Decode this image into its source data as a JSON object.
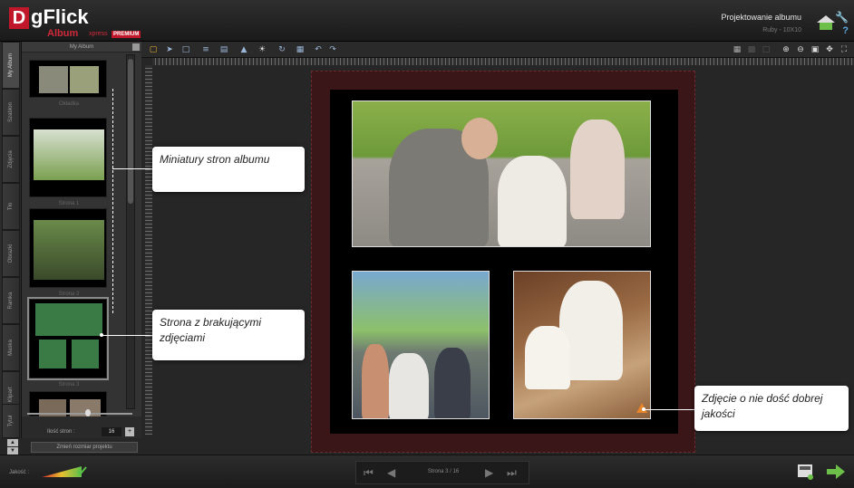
{
  "app": {
    "brand_letter": "D",
    "brand_name": "gFlick",
    "product": "Album",
    "edition": "xpress",
    "badge": "PREMIUM",
    "project_title": "Projektowanie albumu",
    "project_subtitle": "Ruby - 10X10"
  },
  "tabs": [
    {
      "label": "My Album"
    },
    {
      "label": "Szablon"
    },
    {
      "label": "Zdjęcia"
    },
    {
      "label": "Tło"
    },
    {
      "label": "Obrazki"
    },
    {
      "label": "Ramka"
    },
    {
      "label": "Maska"
    },
    {
      "label": "Klipart"
    },
    {
      "label": "Tytuł"
    }
  ],
  "panel": {
    "header": "My Album",
    "thumbs": [
      {
        "caption": "Okładka"
      },
      {
        "caption": "Strona 1"
      },
      {
        "caption": "Strona 2"
      },
      {
        "caption": "Strona 3"
      }
    ],
    "count_label": "Ilość stron :",
    "count_value": "16",
    "count_btn": "+",
    "resize_label": "Zmień rozmiar projektu"
  },
  "toolbar": {
    "left_icons": [
      "lock-icon",
      "pointer-icon",
      "frame-icon",
      "align-left-icon",
      "align-center-icon",
      "arrange-icon",
      "brightness-icon",
      "rotate-icon",
      "layers-icon",
      "undo-icon",
      "redo-icon"
    ],
    "right_icons": [
      "grid-icon",
      "grid2-icon",
      "grid3-icon",
      "zoom-in-icon",
      "zoom-out-icon",
      "fit-icon",
      "move-icon",
      "fullscreen-icon"
    ]
  },
  "callouts": {
    "thumbs": "Miniatury stron albumu",
    "missing": "Strona z brakującymi zdjęciami",
    "quality": "Zdjęcie o nie dość dobrej jakości"
  },
  "bottom": {
    "quality_label": "Jakość :",
    "page_indicator": "Strona 3 / 16"
  },
  "colors": {
    "accent_red": "#c0182a",
    "link_blue": "#5aa6e0",
    "next_green": "#6cc04a",
    "warning_orange": "#e8842a"
  }
}
